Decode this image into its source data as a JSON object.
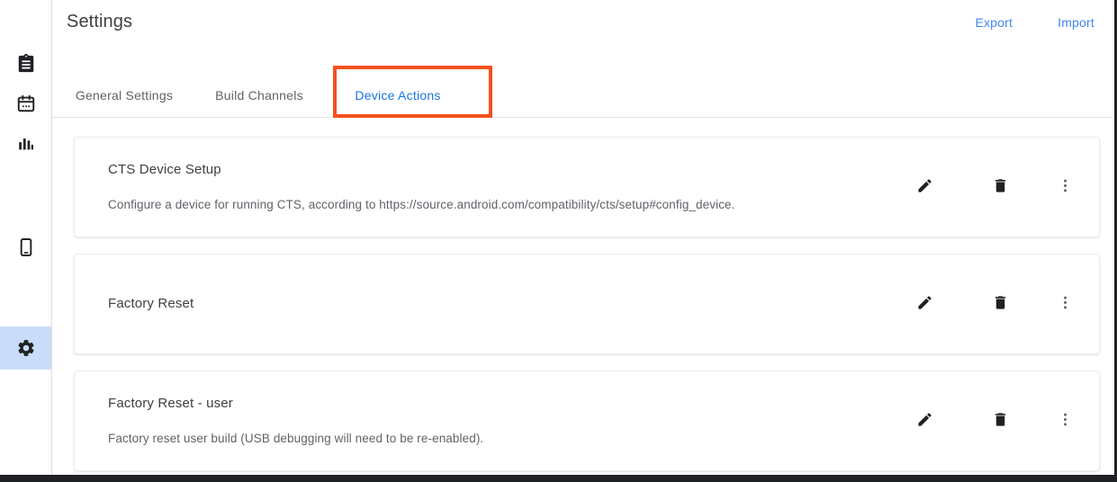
{
  "header": {
    "title": "Settings",
    "export_label": "Export",
    "import_label": "Import"
  },
  "tabs": [
    {
      "label": "General Settings",
      "active": false
    },
    {
      "label": "Build Channels",
      "active": false
    },
    {
      "label": "Device Actions",
      "active": true
    }
  ],
  "sidebar": {
    "items": [
      {
        "name": "clipboard-icon",
        "selected": false
      },
      {
        "name": "calendar-icon",
        "selected": false
      },
      {
        "name": "bar-chart-icon",
        "selected": false
      },
      {
        "name": "device-phone-icon",
        "selected": false
      },
      {
        "name": "gear-icon",
        "selected": true
      }
    ]
  },
  "device_actions": [
    {
      "title": "CTS Device Setup",
      "description": "Configure a device for running CTS, according to https://source.android.com/compatibility/cts/setup#config_device.",
      "edit_icon": "pencil-icon",
      "delete_icon": "trash-icon",
      "more_icon": "more-vertical-icon"
    },
    {
      "title": "Factory Reset",
      "description": "",
      "edit_icon": "pencil-icon",
      "delete_icon": "trash-icon",
      "more_icon": "more-vertical-icon"
    },
    {
      "title": "Factory Reset - user",
      "description": "Factory reset user build (USB debugging will need to be re-enabled).",
      "edit_icon": "pencil-icon",
      "delete_icon": "trash-icon",
      "more_icon": "more-vertical-icon"
    }
  ],
  "colors": {
    "accent_blue": "#1a73e8",
    "link_blue": "#4285f4",
    "annotation_red": "#f4511e",
    "sidebar_selected_bg": "#c9ddfb",
    "text_primary": "#3c4043",
    "text_secondary": "#5f6368",
    "icon_dark": "#202124"
  },
  "annotation": {
    "target": "Device Actions",
    "shape": "rectangle",
    "color": "#f4511e"
  }
}
